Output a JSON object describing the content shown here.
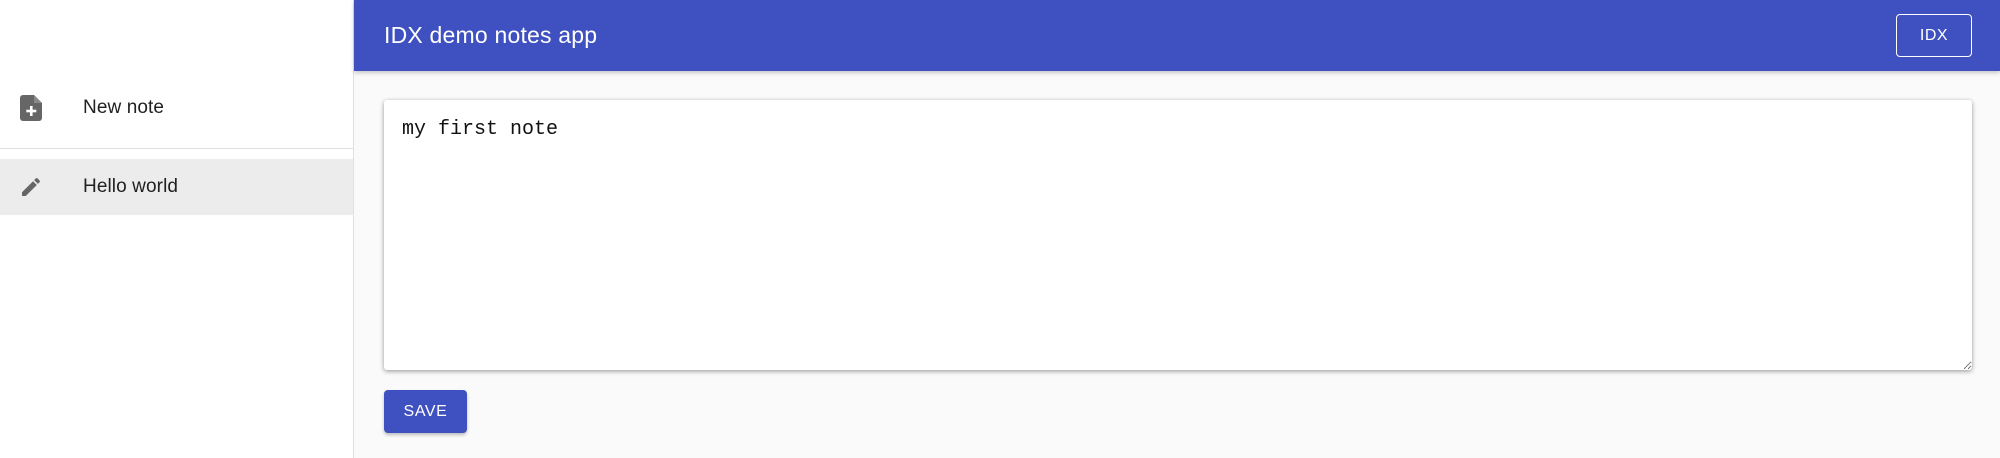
{
  "header": {
    "title": "IDX demo notes app",
    "idx_label": "IDX"
  },
  "sidebar": {
    "items": [
      {
        "label": "New note",
        "icon": "note-add-icon"
      },
      {
        "label": "Hello world",
        "icon": "pencil-icon",
        "selected": true
      }
    ]
  },
  "editor": {
    "value": "my first note"
  },
  "actions": {
    "save_label": "SAVE"
  },
  "colors": {
    "primary": "#3f51c0",
    "selected_bg": "#ececec",
    "icon": "#666666"
  }
}
